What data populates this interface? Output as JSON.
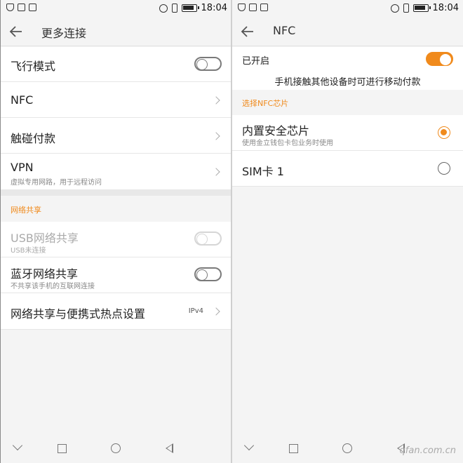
{
  "left": {
    "status": {
      "time": "18:04"
    },
    "title": "更多连接",
    "rows": [
      {
        "label": "飞行模式"
      },
      {
        "label": "NFC"
      },
      {
        "label": "触碰付款"
      },
      {
        "label": "VPN",
        "sub": "虚拟专用网路，用于远程访问"
      }
    ],
    "section_title": "网络共享",
    "sharing": [
      {
        "label": "USB网络共享",
        "sub": "USB未连接"
      },
      {
        "label": "蓝牙网络共享",
        "sub": "不共享该手机的互联网连接"
      },
      {
        "label": "网络共享与便携式热点设置",
        "meta": "IPv4"
      }
    ]
  },
  "right": {
    "status": {
      "time": "18:04"
    },
    "title": "NFC",
    "enabled_label": "已开启",
    "caption": "手机接触其他设备时可进行移动付款",
    "section_title": "选择NFC芯片",
    "chips": [
      {
        "label": "内置安全芯片",
        "sub": "使用金立钱包卡包业务时使用",
        "selected": true
      },
      {
        "label": "SIM卡 1",
        "selected": false
      }
    ],
    "watermark": "qfan.com.cn"
  },
  "colors": {
    "accent": "#f08a1c"
  }
}
